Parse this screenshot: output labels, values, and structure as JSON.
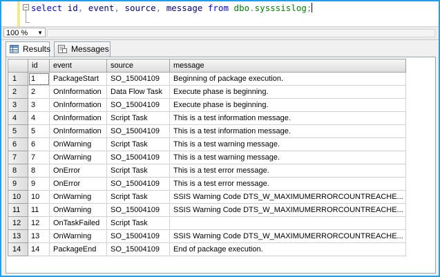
{
  "editor": {
    "query_tokens": [
      {
        "t": "select",
        "c": "kw"
      },
      {
        "t": " id",
        "c": "plain"
      },
      {
        "t": ",",
        "c": "gr"
      },
      {
        "t": " event",
        "c": "plain"
      },
      {
        "t": ",",
        "c": "gr"
      },
      {
        "t": " source",
        "c": "plain"
      },
      {
        "t": ",",
        "c": "gr"
      },
      {
        "t": " message ",
        "c": "plain"
      },
      {
        "t": "from",
        "c": "kw"
      },
      {
        "t": " dbo",
        "c": "fn"
      },
      {
        "t": ".",
        "c": "gr"
      },
      {
        "t": "sysssislog",
        "c": "fn"
      },
      {
        "t": ";",
        "c": "gr"
      }
    ],
    "collapse_glyph": "−"
  },
  "zoom": {
    "value": "100 %"
  },
  "tabs": [
    {
      "label": "Results",
      "icon": "grid-icon"
    },
    {
      "label": "Messages",
      "icon": "messages-icon"
    }
  ],
  "grid": {
    "columns": [
      "id",
      "event",
      "source",
      "message"
    ],
    "rows": [
      [
        "1",
        "1",
        "PackageStart",
        "SO_15004109",
        "Beginning of package execution."
      ],
      [
        "2",
        "2",
        "OnInformation",
        "Data Flow Task",
        "Execute phase is beginning."
      ],
      [
        "3",
        "3",
        "OnInformation",
        "SO_15004109",
        "Execute phase is beginning."
      ],
      [
        "4",
        "4",
        "OnInformation",
        "Script Task",
        "This is a test information message."
      ],
      [
        "5",
        "5",
        "OnInformation",
        "SO_15004109",
        "This is a test information message."
      ],
      [
        "6",
        "6",
        "OnWarning",
        "Script Task",
        "This is a test warning message."
      ],
      [
        "7",
        "7",
        "OnWarning",
        "SO_15004109",
        "This is a test warning message."
      ],
      [
        "8",
        "8",
        "OnError",
        "Script Task",
        "This is a test error message."
      ],
      [
        "9",
        "9",
        "OnError",
        "SO_15004109",
        "This is a test error message."
      ],
      [
        "10",
        "10",
        "OnWarning",
        "Script Task",
        "SSIS Warning Code DTS_W_MAXIMUMERRORCOUNTREACHE..."
      ],
      [
        "11",
        "11",
        "OnWarning",
        "SO_15004109",
        "SSIS Warning Code DTS_W_MAXIMUMERRORCOUNTREACHE..."
      ],
      [
        "12",
        "12",
        "OnTaskFailed",
        "Script Task",
        ""
      ],
      [
        "13",
        "13",
        "OnWarning",
        "SO_15004109",
        "SSIS Warning Code DTS_W_MAXIMUMERRORCOUNTREACHE..."
      ],
      [
        "14",
        "14",
        "PackageEnd",
        "SO_15004109",
        "End of package execution."
      ]
    ]
  },
  "colors": {
    "frame_border": "#1ea0f0",
    "keyword": "#0000ff",
    "identifier": "#000080",
    "object": "#008000"
  }
}
